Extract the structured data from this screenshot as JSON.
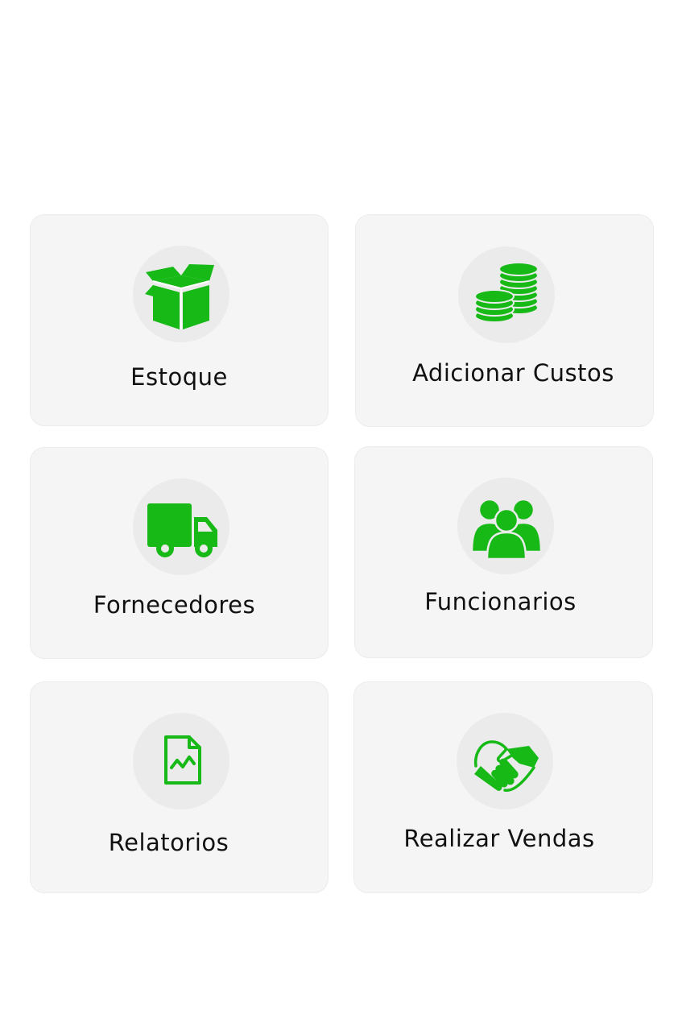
{
  "accent_color": "#16b916",
  "menu": {
    "estoque": {
      "label": "Estoque",
      "icon": "box-icon"
    },
    "custos": {
      "label": "Adicionar Custos",
      "icon": "coins-icon"
    },
    "fornecedores": {
      "label": "Fornecedores",
      "icon": "truck-icon"
    },
    "funcionarios": {
      "label": "Funcionarios",
      "icon": "users-icon"
    },
    "relatorios": {
      "label": "Relatorios",
      "icon": "report-icon"
    },
    "vendas": {
      "label": "Realizar Vendas",
      "icon": "handshake-icon"
    }
  }
}
